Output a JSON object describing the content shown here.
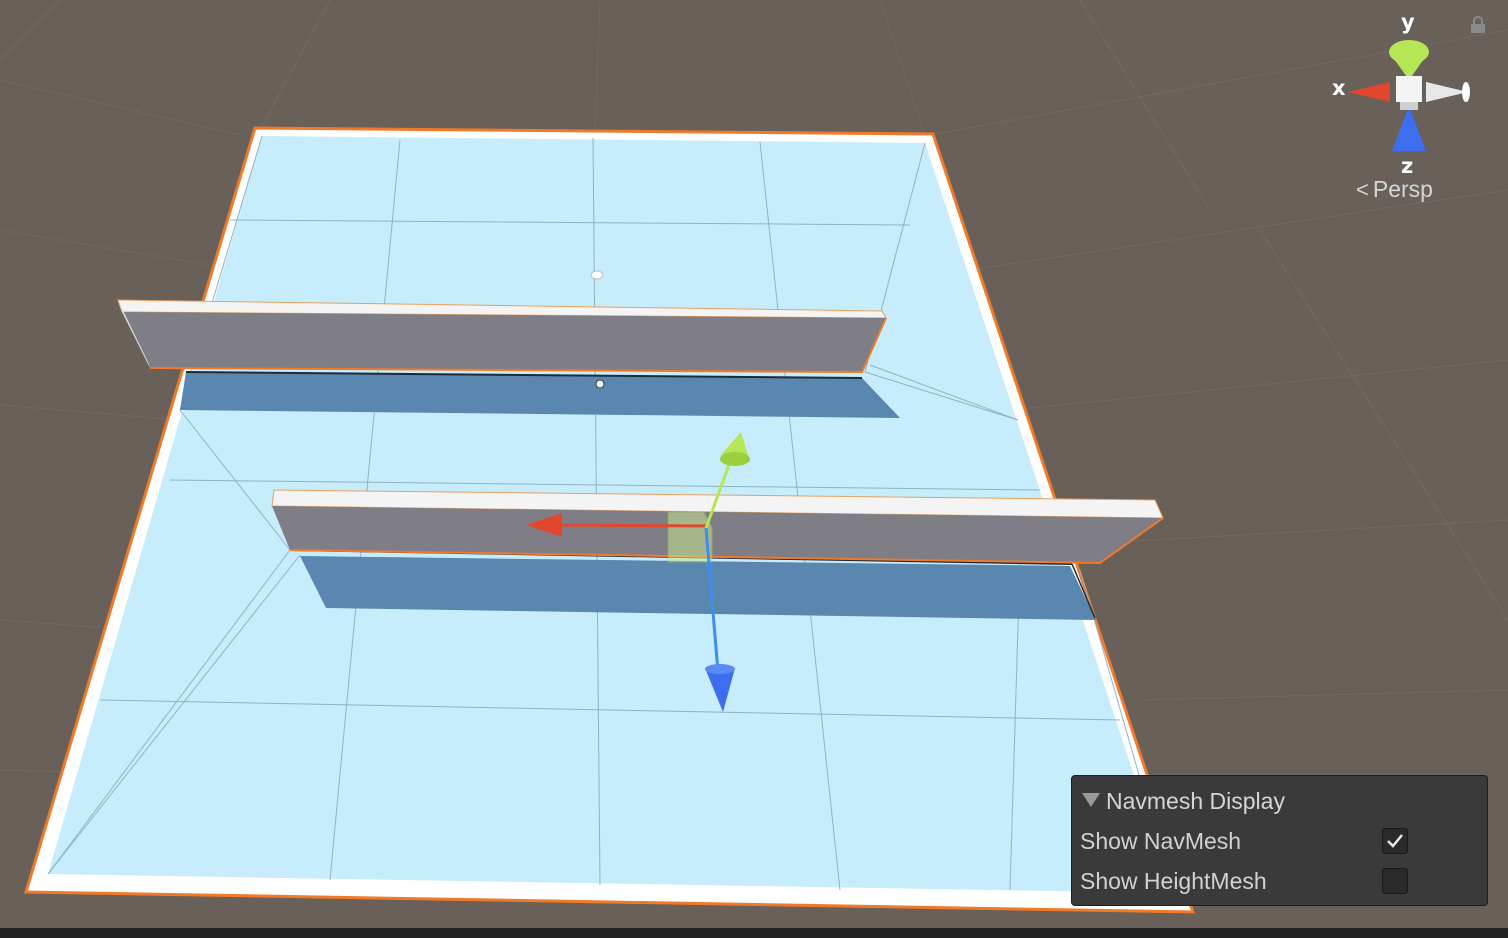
{
  "viewport": {
    "background_color": "#686059",
    "camera_mode": "Persp"
  },
  "gizmo": {
    "x_label": "x",
    "y_label": "y",
    "z_label": "z",
    "x_color": "#e0472c",
    "y_color": "#b5e655",
    "z_color": "#3d6ef0",
    "icons": [
      "lock-icon",
      "chevron-left-icon"
    ]
  },
  "scene": {
    "navmesh_color": "#c7ecfb",
    "selection_outline_color": "#f07a2a",
    "wall_color": "#7f7e87",
    "move_tool_icons": [
      "x-axis-arrow",
      "y-axis-cone",
      "z-axis-arrow"
    ]
  },
  "navmesh_panel": {
    "title": "Navmesh Display",
    "rows": [
      {
        "label": "Show NavMesh",
        "checked": true
      },
      {
        "label": "Show HeightMesh",
        "checked": false
      }
    ]
  }
}
